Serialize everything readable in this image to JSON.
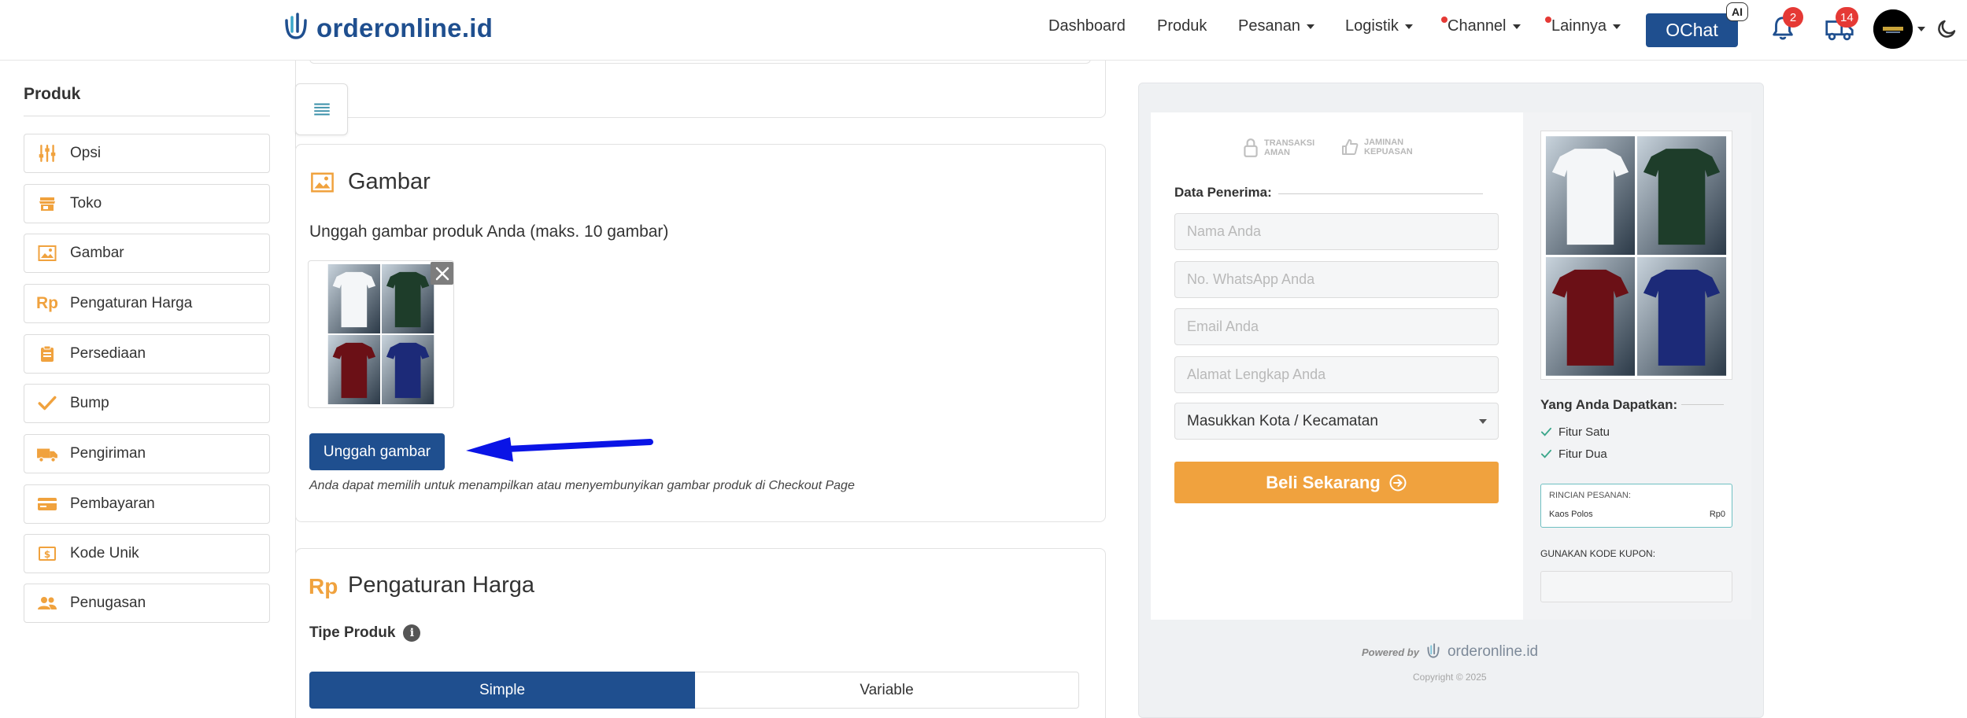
{
  "brand": {
    "logo_text": "orderonline.id"
  },
  "nav": {
    "items": [
      {
        "label": "Dashboard",
        "dropdown": false,
        "dot": false
      },
      {
        "label": "Produk",
        "dropdown": false,
        "dot": false
      },
      {
        "label": "Pesanan",
        "dropdown": true,
        "dot": false
      },
      {
        "label": "Logistik",
        "dropdown": true,
        "dot": false
      },
      {
        "label": "Channel",
        "dropdown": true,
        "dot": true
      },
      {
        "label": "Lainnya",
        "dropdown": true,
        "dot": true
      }
    ],
    "ochat_label": "OChat",
    "ai_badge": "AI",
    "notif_count": "2",
    "shipping_count": "14"
  },
  "sidebar": {
    "title": "Produk",
    "items": [
      {
        "label": "Opsi",
        "icon": "sliders-icon"
      },
      {
        "label": "Toko",
        "icon": "store-icon"
      },
      {
        "label": "Gambar",
        "icon": "image-icon"
      },
      {
        "label": "Pengaturan Harga",
        "icon": "rupiah-icon"
      },
      {
        "label": "Persediaan",
        "icon": "clipboard-icon"
      },
      {
        "label": "Bump",
        "icon": "check-icon"
      },
      {
        "label": "Pengiriman",
        "icon": "truck-icon"
      },
      {
        "label": "Pembayaran",
        "icon": "card-icon"
      },
      {
        "label": "Kode Unik",
        "icon": "dollar-box-icon"
      },
      {
        "label": "Penugasan",
        "icon": "people-icon"
      }
    ]
  },
  "gambar": {
    "title": "Gambar",
    "subtitle": "Unggah gambar produk Anda (maks. 10 gambar)",
    "upload_label": "Unggah gambar",
    "help": "Anda dapat memilih untuk menampilkan atau menyembunyikan gambar produk di Checkout Page"
  },
  "harga": {
    "icon_text": "Rp",
    "title": "Pengaturan Harga",
    "tipe_label": "Tipe Produk",
    "options": [
      "Simple",
      "Variable"
    ],
    "selected": "Simple"
  },
  "preview": {
    "trust": [
      {
        "l1": "TRANSAKSI",
        "l2": "AMAN"
      },
      {
        "l1": "JAMINAN",
        "l2": "KEPUASAN"
      }
    ],
    "data_penerima": "Data Penerima:",
    "placeholders": [
      "Nama Anda",
      "No. WhatsApp Anda",
      "Email Anda",
      "Alamat Lengkap Anda"
    ],
    "kota_select": "Masukkan Kota / Kecamatan",
    "buy_label": "Beli Sekarang",
    "yang_anda": "Yang Anda Dapatkan:",
    "features": [
      "Fitur Satu",
      "Fitur Dua"
    ],
    "rincian_title": "RINCIAN PESANAN:",
    "rincian_item": "Kaos Polos",
    "rincian_price": "Rp0",
    "kupon_label": "GUNAKAN KODE KUPON:",
    "powered_by": "Powered by",
    "powered_logo": "orderonline.id",
    "copyright": "Copyright © 2025"
  },
  "colors": {
    "primary": "#1f4f8f",
    "accent_orange": "#f0a23e",
    "icon_orange": "#f0a23e",
    "badge_red": "#e53935",
    "arrow_blue": "#0a14e6",
    "shirts": [
      "#f4f6f8",
      "#1e3d2a",
      "#6b1016",
      "#1c2a78"
    ]
  }
}
